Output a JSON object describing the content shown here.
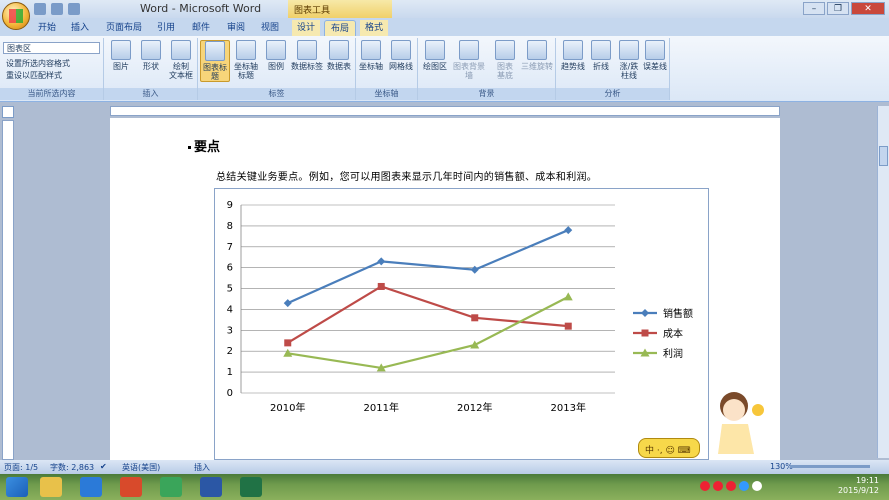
{
  "window": {
    "title": "Word - Microsoft Word",
    "tools_title": "图表工具",
    "controls": [
      "–",
      "❐",
      "✕"
    ]
  },
  "tabs": [
    {
      "label": "开始"
    },
    {
      "label": "插入"
    },
    {
      "label": "页面布局"
    },
    {
      "label": "引用"
    },
    {
      "label": "邮件"
    },
    {
      "label": "审阅"
    },
    {
      "label": "视图"
    },
    {
      "label": "设计"
    },
    {
      "label": "布局"
    },
    {
      "label": "格式"
    }
  ],
  "ribbon": {
    "current_selection": {
      "dropdown": "图表区",
      "cmd1": "设置所选内容格式",
      "cmd2": "重设以匹配样式",
      "label": "当前所选内容"
    },
    "insert": {
      "pic": "图片",
      "shape": "形状",
      "textbox": "绘制\n文本框",
      "label": "插入"
    },
    "labels": {
      "b1": "图表标题",
      "b2": "坐标轴\n标题",
      "b3": "图例",
      "b4": "数据标签",
      "b5": "数据表",
      "label": "标签"
    },
    "axes": {
      "b1": "坐标轴",
      "b2": "网格线",
      "label": "坐标轴"
    },
    "background": {
      "b1": "绘图区",
      "b2": "图表背景墙",
      "b3": "图表\n基底",
      "b4": "三维旋转",
      "label": "背景"
    },
    "analysis": {
      "b1": "趋势线",
      "b2": "折线",
      "b3": "涨/跌\n柱线",
      "b4": "误差线",
      "label": "分析"
    }
  },
  "document": {
    "heading": "要点",
    "body": "总结关键业务要点。例如，您可以用图表来显示几年时间内的销售额、成本和利润。"
  },
  "chart_data": {
    "type": "line",
    "categories": [
      "2010年",
      "2011年",
      "2012年",
      "2013年"
    ],
    "ylim": [
      0,
      9
    ],
    "yticks": [
      "0",
      "1",
      "2",
      "3",
      "4",
      "5",
      "6",
      "7",
      "8",
      "9"
    ],
    "series": [
      {
        "name": "销售额",
        "values": [
          4.3,
          6.3,
          5.9,
          7.8
        ],
        "color": "#4a7ebb",
        "marker": "diamond"
      },
      {
        "name": "成本",
        "values": [
          2.4,
          5.1,
          3.6,
          3.2
        ],
        "color": "#be4b48",
        "marker": "square"
      },
      {
        "name": "利润",
        "values": [
          1.9,
          1.2,
          2.3,
          4.6
        ],
        "color": "#98b954",
        "marker": "triangle"
      }
    ],
    "legend": "right",
    "grid": true
  },
  "status": {
    "page": "页面: 1/5",
    "words": "字数: 2,863",
    "lang": "英语(美国)",
    "mode": "插入",
    "zoom": "130%"
  },
  "taskbar": {
    "time": "19:11",
    "date": "2015/9/12"
  },
  "ime": {
    "text": "中 ·, ☺ ⌨"
  }
}
